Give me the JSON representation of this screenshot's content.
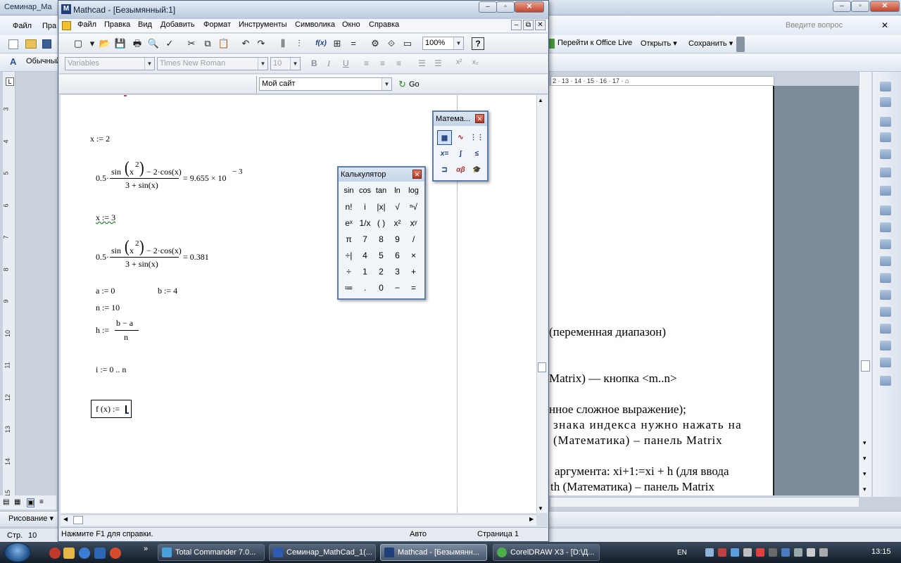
{
  "word": {
    "title": "Семинар_Ма",
    "menu": [
      "Файл",
      "Пра"
    ],
    "style_combo": "Обычный",
    "help_placeholder": "Введите вопрос",
    "toolbar": {
      "office_live": "Перейти к Office Live",
      "open": "Открыть",
      "save": "Сохранить"
    },
    "ruler_h": "2 · 13 · 14 · 15 · 16 · 17 · ⌂",
    "ruler_v": [
      "3",
      "4",
      "5",
      "6",
      "7",
      "8",
      "9",
      "10",
      "11",
      "12",
      "13",
      "14",
      "15"
    ],
    "doc_lines": [
      "(переменная диапазон)",
      "Matrix) — кнопка <m..n>",
      "нное сложное выражение);",
      "знака индекса нужно нажать на",
      "(Математика) – панель Matrix",
      "аргумента: xi+1:=xi + h (для ввода",
      "th (Математика) – панель Matrix"
    ],
    "drawing_label": "Рисование",
    "status": {
      "page": "Стр.",
      "page_num": "10"
    }
  },
  "mathcad": {
    "title": "Mathcad - [Безымянный:1]",
    "menu": [
      "Файл",
      "Правка",
      "Вид",
      "Добавить",
      "Формат",
      "Инструменты",
      "Символика",
      "Окно",
      "Справка"
    ],
    "zoom": "100%",
    "style_combo": "Variables",
    "font_combo": "Times New Roman",
    "size_combo": "10",
    "url_combo": "Мой сайт",
    "go_label": "Go",
    "status": {
      "help": "Нажмите F1 для справки.",
      "mode": "Авто",
      "page": "Страница 1"
    }
  },
  "worksheet": {
    "x_def_1": "x := 2",
    "coef_1": "0.5·",
    "num_1": "sin",
    "num_x": "x",
    "num_pow": "2",
    "num_tail": "− 2·cos(x)",
    "den": "3 + sin(x)",
    "res_1_a": "= 9.655 × 10",
    "res_1_exp": "− 3",
    "x_def_2": "x := 3",
    "res_2": "= 0.381",
    "a_def": "a := 0",
    "b_def": "b := 4",
    "n_def": "n := 10",
    "h_lhs": "h :=",
    "h_num": "b − a",
    "h_den": "n",
    "i_def": "i := 0 .. n",
    "f_def": "f (x) := "
  },
  "calculator": {
    "title": "Калькулятор",
    "rows": [
      [
        "sin",
        "cos",
        "tan",
        "ln",
        "log"
      ],
      [
        "n!",
        "i",
        "|x|",
        "√",
        "ⁿ√"
      ],
      [
        "eˣ",
        "1/x",
        "( )",
        "x²",
        "xʸ"
      ],
      [
        "π",
        "7",
        "8",
        "9",
        "/"
      ],
      [
        "÷|",
        "4",
        "5",
        "6",
        "×"
      ],
      [
        "÷",
        "1",
        "2",
        "3",
        "+"
      ],
      [
        "≔",
        ".",
        "0",
        "−",
        "="
      ]
    ]
  },
  "math_palette": {
    "title": "Матема...",
    "buttons": [
      "calc",
      "graph",
      "matrix",
      "x=",
      "∫d/dx",
      "<≤",
      "prog",
      "αβ",
      "cap"
    ]
  }
}
